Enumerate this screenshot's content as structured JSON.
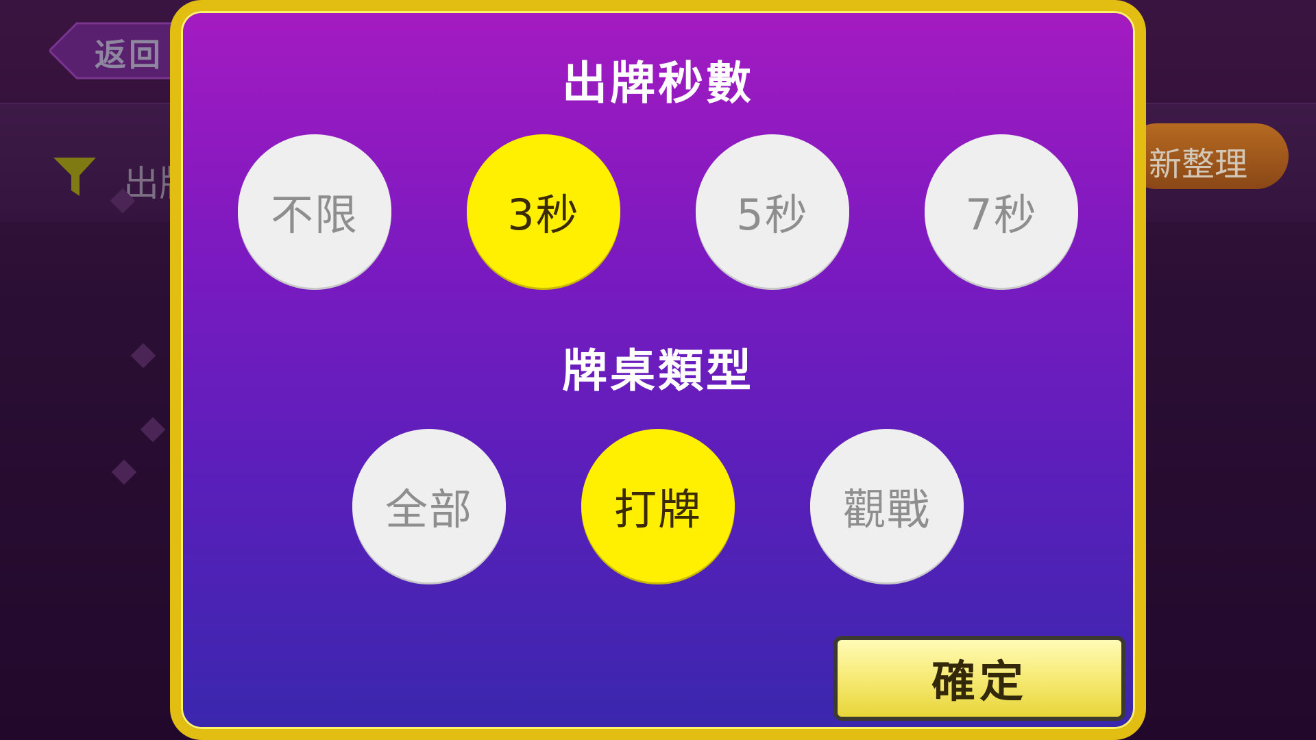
{
  "background": {
    "back_label": "返回",
    "filter_label": "出牌",
    "sort_label": "新整理"
  },
  "modal": {
    "turn_time": {
      "title": "出牌秒數",
      "options": [
        {
          "label": "不限",
          "selected": false
        },
        {
          "label": "3秒",
          "selected": true
        },
        {
          "label": "5秒",
          "selected": false
        },
        {
          "label": "7秒",
          "selected": false
        }
      ]
    },
    "table_type": {
      "title": "牌桌類型",
      "options": [
        {
          "label": "全部",
          "selected": false
        },
        {
          "label": "打牌",
          "selected": true
        },
        {
          "label": "觀戰",
          "selected": false
        }
      ]
    },
    "confirm_label": "確定"
  },
  "colors": {
    "selected": "#ffef00",
    "unselected": "#efefef",
    "frame": "#e2be12"
  }
}
